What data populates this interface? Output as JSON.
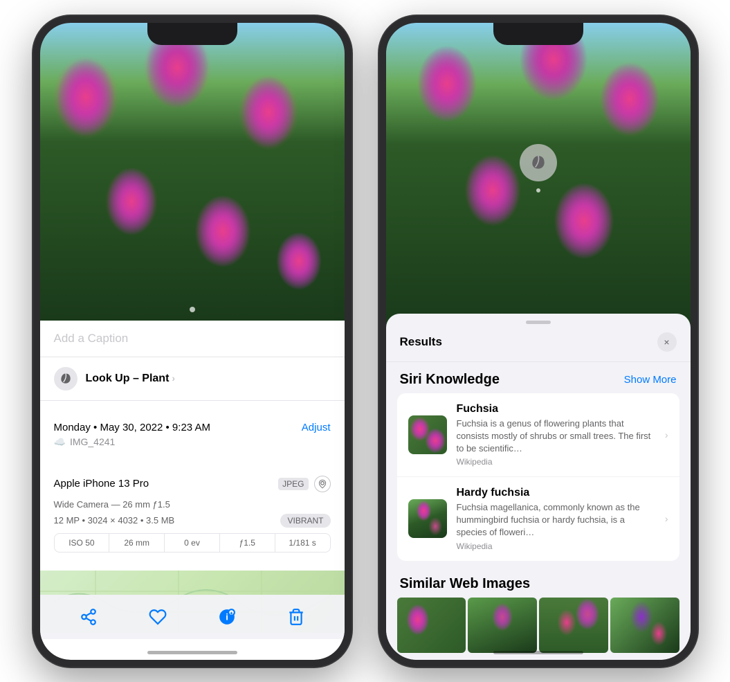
{
  "left_phone": {
    "caption_placeholder": "Add a Caption",
    "lookup": {
      "label_bold": "Look Up –",
      "label_regular": " Plant",
      "chevron": "›"
    },
    "date": "Monday • May 30, 2022 • 9:23 AM",
    "adjust": "Adjust",
    "filename": "IMG_4241",
    "device": {
      "name": "Apple iPhone 13 Pro",
      "format_badge": "JPEG",
      "camera": "Wide Camera — 26 mm ƒ1.5",
      "mp": "12 MP  •  3024 × 4032  •  3.5 MB",
      "vibrant": "VIBRANT",
      "exif": [
        "ISO 50",
        "26 mm",
        "0 ev",
        "ƒ1.5",
        "1/181 s"
      ]
    },
    "toolbar": {
      "share": "share",
      "heart": "heart",
      "info": "info",
      "trash": "trash"
    }
  },
  "right_phone": {
    "results": {
      "title": "Results",
      "close": "×"
    },
    "siri_knowledge": {
      "title": "Siri Knowledge",
      "show_more": "Show More",
      "items": [
        {
          "name": "Fuchsia",
          "description": "Fuchsia is a genus of flowering plants that consists mostly of shrubs or small trees. The first to be scientific…",
          "source": "Wikipedia"
        },
        {
          "name": "Hardy fuchsia",
          "description": "Fuchsia magellanica, commonly known as the hummingbird fuchsia or hardy fuchsia, is a species of floweri…",
          "source": "Wikipedia"
        }
      ]
    },
    "similar_web": {
      "title": "Similar Web Images"
    }
  }
}
